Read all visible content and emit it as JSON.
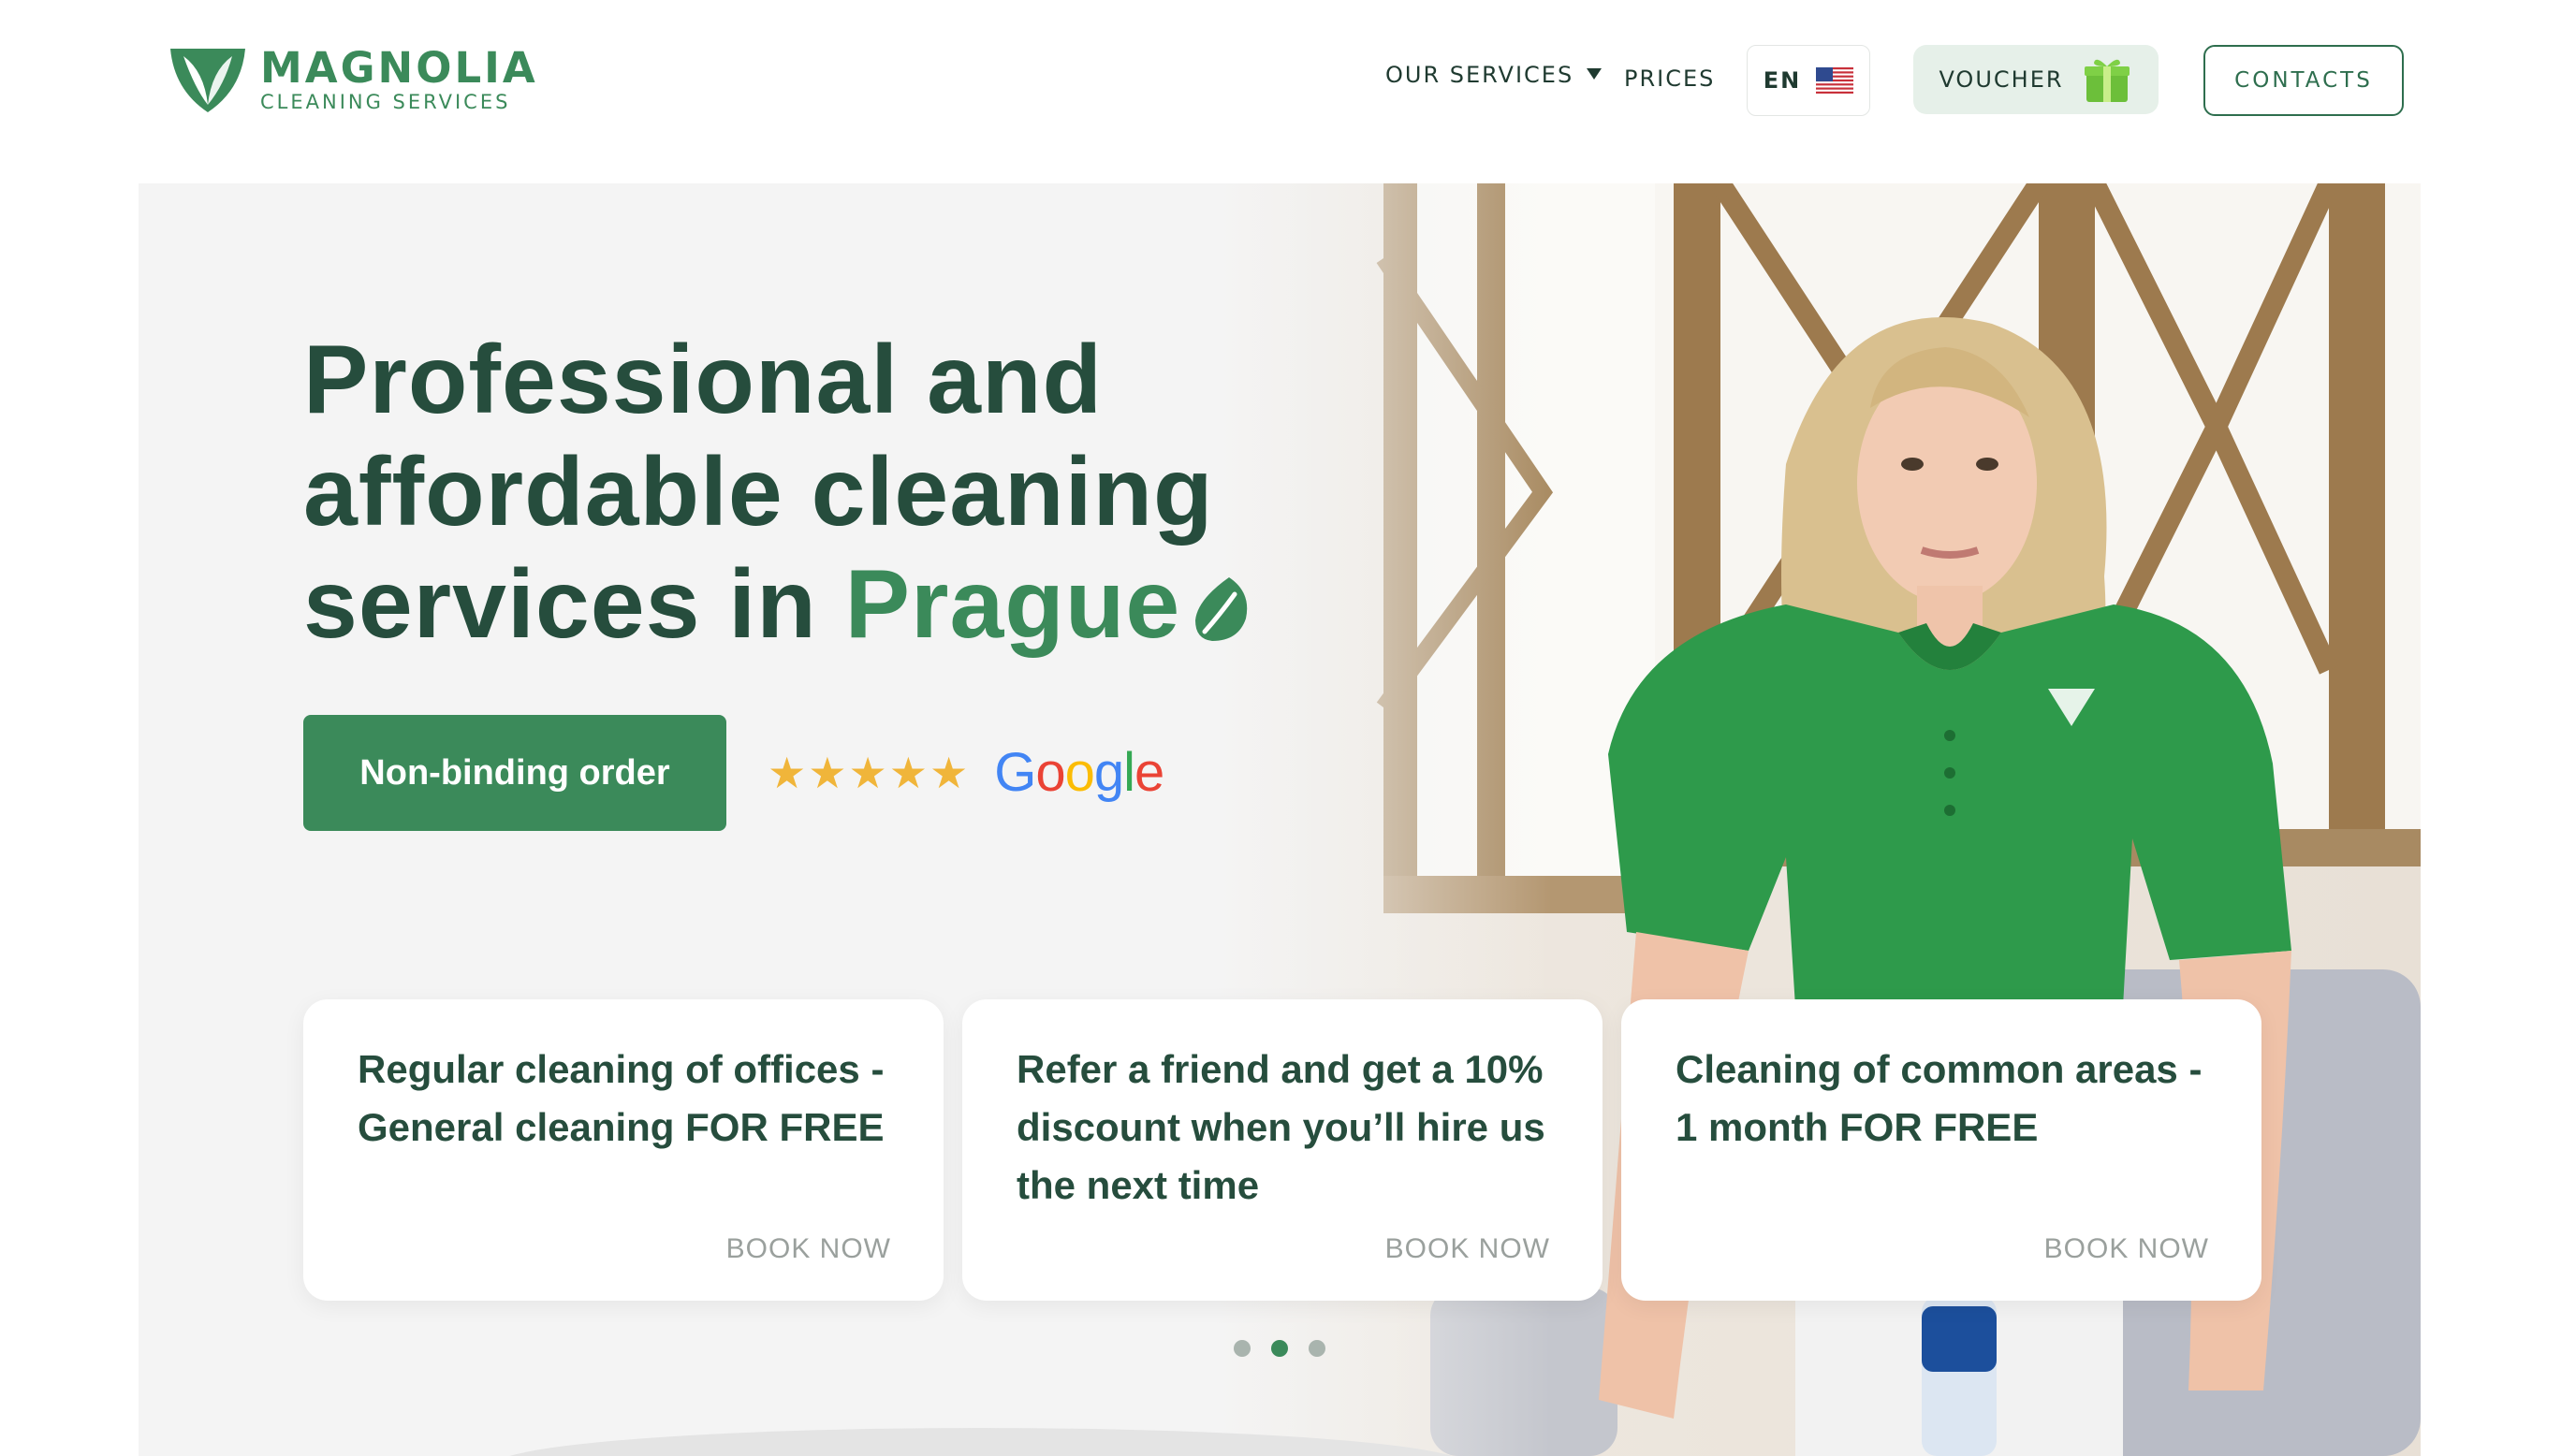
{
  "brand": {
    "name": "MAGNOLIA",
    "tagline": "CLEANING SERVICES",
    "accent_color": "#3b8a5a",
    "dark_color": "#264d3d"
  },
  "nav": {
    "services_label": "OUR SERVICES",
    "prices_label": "PRICES",
    "language_label": "EN",
    "language_flag": "us-flag-icon",
    "voucher_label": "VOUCHER",
    "voucher_icon": "gift-icon",
    "contacts_label": "CONTACTS"
  },
  "hero": {
    "title_line1": "Professional and",
    "title_line2": "affordable cleaning",
    "title_line3_prefix": "services in ",
    "title_accent": "Prague",
    "cta_label": "Non-binding order",
    "rating_stars": "★★★★★",
    "rating_value": 5,
    "rating_source": "Google"
  },
  "offers": [
    {
      "text": "Regular cleaning of offices - General cleaning FOR FREE",
      "cta": "BOOK NOW"
    },
    {
      "text": "Refer a friend and get a 10% discount when you’ll hire us the next time",
      "cta": "BOOK NOW"
    },
    {
      "text": "Cleaning of common areas - 1 month FOR FREE",
      "cta": "BOOK NOW"
    }
  ],
  "carousel": {
    "slide_count": 3,
    "active_index": 1
  }
}
